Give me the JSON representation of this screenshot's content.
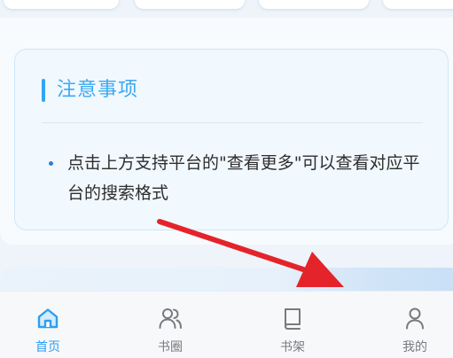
{
  "notice": {
    "title": "注意事项",
    "items": [
      "点击上方支持平台的\"查看更多\"可以查看对应平台的搜索格式"
    ]
  },
  "tabbar": {
    "items": [
      {
        "label": "首页",
        "icon": "home-icon",
        "active": true
      },
      {
        "label": "书圈",
        "icon": "users-icon",
        "active": false
      },
      {
        "label": "书架",
        "icon": "book-icon",
        "active": false
      },
      {
        "label": "我的",
        "icon": "user-icon",
        "active": false
      }
    ]
  },
  "annotation": {
    "icon": "red-arrow-icon",
    "color": "#e5232a"
  },
  "colors": {
    "accent": "#2f9ef0",
    "notice_title": "#3ea9ef",
    "tab_inactive": "#777b80"
  }
}
